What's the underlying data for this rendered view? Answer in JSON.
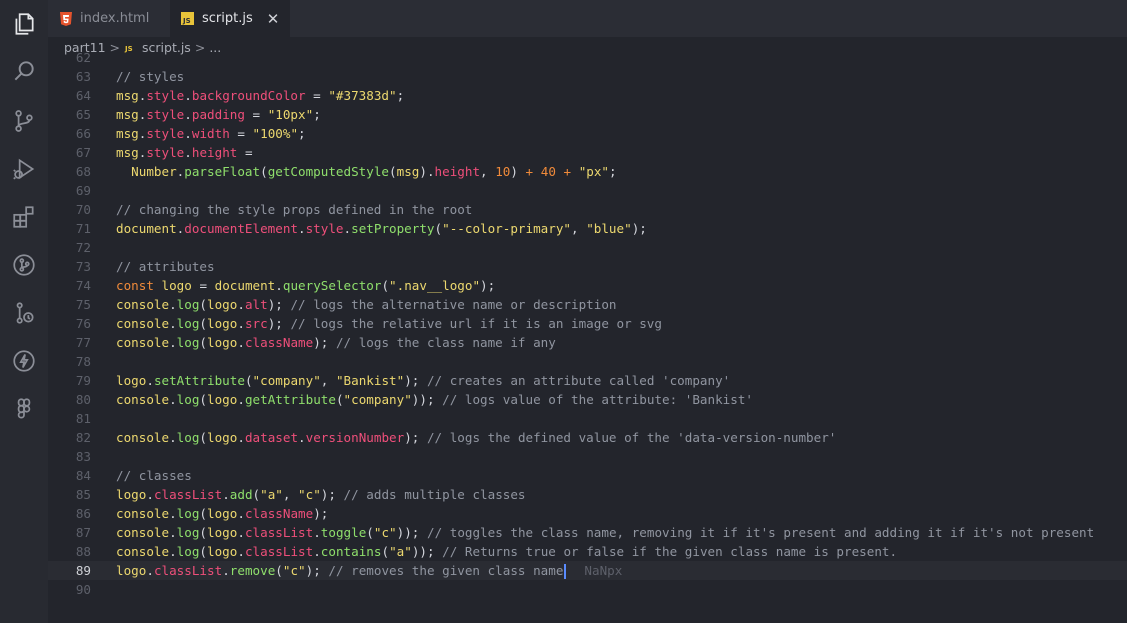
{
  "tabs": [
    {
      "label": "index.html",
      "icon": "html5-icon",
      "active": false
    },
    {
      "label": "script.js",
      "icon": "js-icon",
      "active": true
    }
  ],
  "tab_close": "✕",
  "breadcrumb": {
    "folder": "part11",
    "sep1": ">",
    "js_badge": "JS",
    "file": "script.js",
    "sep2": ">",
    "more": "..."
  },
  "editor": {
    "current_line": "89",
    "inline_hint": "NaNpx",
    "lines": [
      {
        "n": "62",
        "tokens": []
      },
      {
        "n": "63",
        "tokens": [
          [
            "cm",
            "// styles"
          ]
        ]
      },
      {
        "n": "64",
        "tokens": [
          [
            "obj",
            "msg"
          ],
          [
            "punc",
            "."
          ],
          [
            "prop",
            "style"
          ],
          [
            "punc",
            "."
          ],
          [
            "prop",
            "backgroundColor"
          ],
          [
            "punc",
            " = "
          ],
          [
            "str",
            "\"#37383d\""
          ],
          [
            "punc",
            ";"
          ]
        ]
      },
      {
        "n": "65",
        "tokens": [
          [
            "obj",
            "msg"
          ],
          [
            "punc",
            "."
          ],
          [
            "prop",
            "style"
          ],
          [
            "punc",
            "."
          ],
          [
            "prop",
            "padding"
          ],
          [
            "punc",
            " = "
          ],
          [
            "str",
            "\"10px\""
          ],
          [
            "punc",
            ";"
          ]
        ]
      },
      {
        "n": "66",
        "tokens": [
          [
            "obj",
            "msg"
          ],
          [
            "punc",
            "."
          ],
          [
            "prop",
            "style"
          ],
          [
            "punc",
            "."
          ],
          [
            "prop",
            "width"
          ],
          [
            "punc",
            " = "
          ],
          [
            "str",
            "\"100%\""
          ],
          [
            "punc",
            ";"
          ]
        ]
      },
      {
        "n": "67",
        "tokens": [
          [
            "obj",
            "msg"
          ],
          [
            "punc",
            "."
          ],
          [
            "prop",
            "style"
          ],
          [
            "punc",
            "."
          ],
          [
            "prop",
            "height"
          ],
          [
            "punc",
            " ="
          ]
        ]
      },
      {
        "n": "68",
        "tokens": [
          [
            "punc",
            "  "
          ],
          [
            "obj",
            "Number"
          ],
          [
            "punc",
            "."
          ],
          [
            "fn",
            "parseFloat"
          ],
          [
            "punc",
            "("
          ],
          [
            "fn",
            "getComputedStyle"
          ],
          [
            "punc",
            "("
          ],
          [
            "obj",
            "msg"
          ],
          [
            "punc",
            ")."
          ],
          [
            "prop",
            "height"
          ],
          [
            "punc",
            ", "
          ],
          [
            "num",
            "10"
          ],
          [
            "punc",
            ") "
          ],
          [
            "kw",
            "+"
          ],
          [
            "punc",
            " "
          ],
          [
            "num",
            "40"
          ],
          [
            "punc",
            " "
          ],
          [
            "kw",
            "+"
          ],
          [
            "punc",
            " "
          ],
          [
            "str",
            "\"px\""
          ],
          [
            "punc",
            ";"
          ]
        ]
      },
      {
        "n": "69",
        "tokens": []
      },
      {
        "n": "70",
        "tokens": [
          [
            "cm",
            "// changing the style props defined in the root"
          ]
        ]
      },
      {
        "n": "71",
        "tokens": [
          [
            "obj",
            "document"
          ],
          [
            "punc",
            "."
          ],
          [
            "prop",
            "documentElement"
          ],
          [
            "punc",
            "."
          ],
          [
            "prop",
            "style"
          ],
          [
            "punc",
            "."
          ],
          [
            "fn",
            "setProperty"
          ],
          [
            "punc",
            "("
          ],
          [
            "str",
            "\"--color-primary\""
          ],
          [
            "punc",
            ", "
          ],
          [
            "str",
            "\"blue\""
          ],
          [
            "punc",
            ");"
          ]
        ]
      },
      {
        "n": "72",
        "tokens": []
      },
      {
        "n": "73",
        "tokens": [
          [
            "cm",
            "// attributes"
          ]
        ]
      },
      {
        "n": "74",
        "tokens": [
          [
            "kw",
            "const"
          ],
          [
            "punc",
            " "
          ],
          [
            "obj",
            "logo"
          ],
          [
            "punc",
            " = "
          ],
          [
            "obj",
            "document"
          ],
          [
            "punc",
            "."
          ],
          [
            "fn",
            "querySelector"
          ],
          [
            "punc",
            "("
          ],
          [
            "str",
            "\".nav__logo\""
          ],
          [
            "punc",
            ");"
          ]
        ]
      },
      {
        "n": "75",
        "tokens": [
          [
            "obj",
            "console"
          ],
          [
            "punc",
            "."
          ],
          [
            "fn",
            "log"
          ],
          [
            "punc",
            "("
          ],
          [
            "obj",
            "logo"
          ],
          [
            "punc",
            "."
          ],
          [
            "prop",
            "alt"
          ],
          [
            "punc",
            "); "
          ],
          [
            "cm",
            "// logs the alternative name or description"
          ]
        ]
      },
      {
        "n": "76",
        "tokens": [
          [
            "obj",
            "console"
          ],
          [
            "punc",
            "."
          ],
          [
            "fn",
            "log"
          ],
          [
            "punc",
            "("
          ],
          [
            "obj",
            "logo"
          ],
          [
            "punc",
            "."
          ],
          [
            "prop",
            "src"
          ],
          [
            "punc",
            "); "
          ],
          [
            "cm",
            "// logs the relative url if it is an image or svg"
          ]
        ]
      },
      {
        "n": "77",
        "tokens": [
          [
            "obj",
            "console"
          ],
          [
            "punc",
            "."
          ],
          [
            "fn",
            "log"
          ],
          [
            "punc",
            "("
          ],
          [
            "obj",
            "logo"
          ],
          [
            "punc",
            "."
          ],
          [
            "prop",
            "className"
          ],
          [
            "punc",
            "); "
          ],
          [
            "cm",
            "// logs the class name if any"
          ]
        ]
      },
      {
        "n": "78",
        "tokens": []
      },
      {
        "n": "79",
        "tokens": [
          [
            "obj",
            "logo"
          ],
          [
            "punc",
            "."
          ],
          [
            "fn",
            "setAttribute"
          ],
          [
            "punc",
            "("
          ],
          [
            "str",
            "\"company\""
          ],
          [
            "punc",
            ", "
          ],
          [
            "str",
            "\"Bankist\""
          ],
          [
            "punc",
            "); "
          ],
          [
            "cm",
            "// creates an attribute called 'company'"
          ]
        ]
      },
      {
        "n": "80",
        "tokens": [
          [
            "obj",
            "console"
          ],
          [
            "punc",
            "."
          ],
          [
            "fn",
            "log"
          ],
          [
            "punc",
            "("
          ],
          [
            "obj",
            "logo"
          ],
          [
            "punc",
            "."
          ],
          [
            "fn",
            "getAttribute"
          ],
          [
            "punc",
            "("
          ],
          [
            "str",
            "\"company\""
          ],
          [
            "punc",
            ")); "
          ],
          [
            "cm",
            "// logs value of the attribute: 'Bankist'"
          ]
        ]
      },
      {
        "n": "81",
        "tokens": []
      },
      {
        "n": "82",
        "tokens": [
          [
            "obj",
            "console"
          ],
          [
            "punc",
            "."
          ],
          [
            "fn",
            "log"
          ],
          [
            "punc",
            "("
          ],
          [
            "obj",
            "logo"
          ],
          [
            "punc",
            "."
          ],
          [
            "prop",
            "dataset"
          ],
          [
            "punc",
            "."
          ],
          [
            "prop",
            "versionNumber"
          ],
          [
            "punc",
            "); "
          ],
          [
            "cm",
            "// logs the defined value of the 'data-version-number'"
          ]
        ]
      },
      {
        "n": "83",
        "tokens": []
      },
      {
        "n": "84",
        "tokens": [
          [
            "cm",
            "// classes"
          ]
        ]
      },
      {
        "n": "85",
        "tokens": [
          [
            "obj",
            "logo"
          ],
          [
            "punc",
            "."
          ],
          [
            "prop",
            "classList"
          ],
          [
            "punc",
            "."
          ],
          [
            "fn",
            "add"
          ],
          [
            "punc",
            "("
          ],
          [
            "str",
            "\"a\""
          ],
          [
            "punc",
            ", "
          ],
          [
            "str",
            "\"c\""
          ],
          [
            "punc",
            "); "
          ],
          [
            "cm",
            "// adds multiple classes"
          ]
        ]
      },
      {
        "n": "86",
        "tokens": [
          [
            "obj",
            "console"
          ],
          [
            "punc",
            "."
          ],
          [
            "fn",
            "log"
          ],
          [
            "punc",
            "("
          ],
          [
            "obj",
            "logo"
          ],
          [
            "punc",
            "."
          ],
          [
            "prop",
            "className"
          ],
          [
            "punc",
            ");"
          ]
        ]
      },
      {
        "n": "87",
        "tokens": [
          [
            "obj",
            "console"
          ],
          [
            "punc",
            "."
          ],
          [
            "fn",
            "log"
          ],
          [
            "punc",
            "("
          ],
          [
            "obj",
            "logo"
          ],
          [
            "punc",
            "."
          ],
          [
            "prop",
            "classList"
          ],
          [
            "punc",
            "."
          ],
          [
            "fn",
            "toggle"
          ],
          [
            "punc",
            "("
          ],
          [
            "str",
            "\"c\""
          ],
          [
            "punc",
            ")); "
          ],
          [
            "cm",
            "// toggles the class name, removing it if it's present and adding it if it's not present"
          ]
        ]
      },
      {
        "n": "88",
        "tokens": [
          [
            "obj",
            "console"
          ],
          [
            "punc",
            "."
          ],
          [
            "fn",
            "log"
          ],
          [
            "punc",
            "("
          ],
          [
            "obj",
            "logo"
          ],
          [
            "punc",
            "."
          ],
          [
            "prop",
            "classList"
          ],
          [
            "punc",
            "."
          ],
          [
            "fn",
            "contains"
          ],
          [
            "punc",
            "("
          ],
          [
            "str",
            "\"a\""
          ],
          [
            "punc",
            ")); "
          ],
          [
            "cm",
            "// Returns true or false if the given class name is present."
          ]
        ]
      },
      {
        "n": "89",
        "tokens": [
          [
            "obj",
            "logo"
          ],
          [
            "punc",
            "."
          ],
          [
            "prop",
            "classList"
          ],
          [
            "punc",
            "."
          ],
          [
            "fn",
            "remove"
          ],
          [
            "punc",
            "("
          ],
          [
            "str",
            "\"c\""
          ],
          [
            "punc",
            "); "
          ],
          [
            "cm",
            "// removes the given class name"
          ]
        ]
      },
      {
        "n": "90",
        "tokens": []
      }
    ]
  },
  "activity_bar": [
    "files-icon",
    "search-icon",
    "source-control-icon",
    "run-debug-icon",
    "extensions-icon",
    "git-graph-icon",
    "remote-icon",
    "lightning-icon",
    "figma-icon"
  ],
  "colors": {
    "background": "#23252c",
    "comment": "#9095a0",
    "string": "#ecd86f",
    "property": "#ee4f7a",
    "function": "#8fdf6c",
    "keyword": "#f08a3a"
  }
}
